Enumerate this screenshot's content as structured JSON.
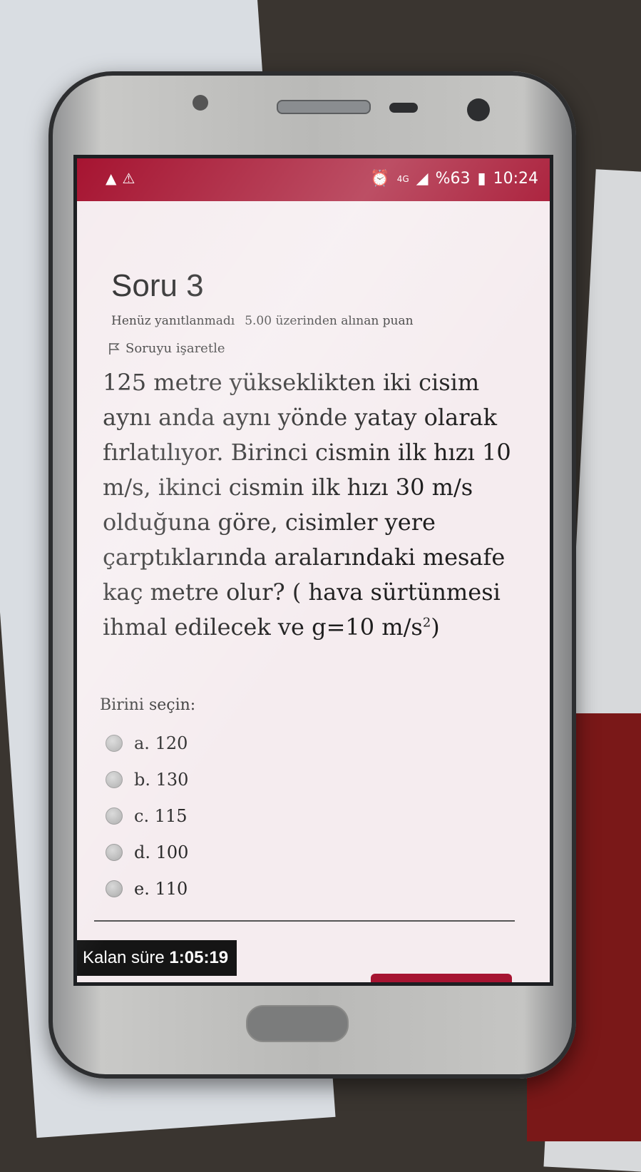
{
  "status_bar": {
    "left_icons": [
      "bag-icon",
      "warning-icon"
    ],
    "network": "4G",
    "battery": "%63",
    "time": "10:24"
  },
  "question": {
    "title": "Soru 3",
    "status": "Henüz yanıtlanmadı",
    "points": "5.00 üzerinden alınan puan",
    "flag_label": "Soruyu işaretle",
    "text": "125 metre yükseklikten iki cisim aynı anda aynı yönde yatay olarak fırlatılıyor. Birinci cismin ilk hızı 10 m/s, ikinci cismin ilk hızı 30 m/s olduğuna göre, cisimler yere çarptıklarında aralarındaki mesafe kaç metre olur? ( hava sürtünmesi ihmal edilecek ve g=10 m/s",
    "text_sup": "2",
    "text_end": ")"
  },
  "answer": {
    "prompt": "Birini seçin:",
    "options": [
      {
        "label": "a. 120"
      },
      {
        "label": "b. 130"
      },
      {
        "label": "c. 115"
      },
      {
        "label": "d. 100"
      },
      {
        "label": "e. 110"
      }
    ]
  },
  "timer": {
    "label": "Kalan süre",
    "value": "1:05:19"
  },
  "colors": {
    "status_bar": "#a61431",
    "screen_bg": "#f5ecef",
    "timer_bg": "#151515"
  }
}
